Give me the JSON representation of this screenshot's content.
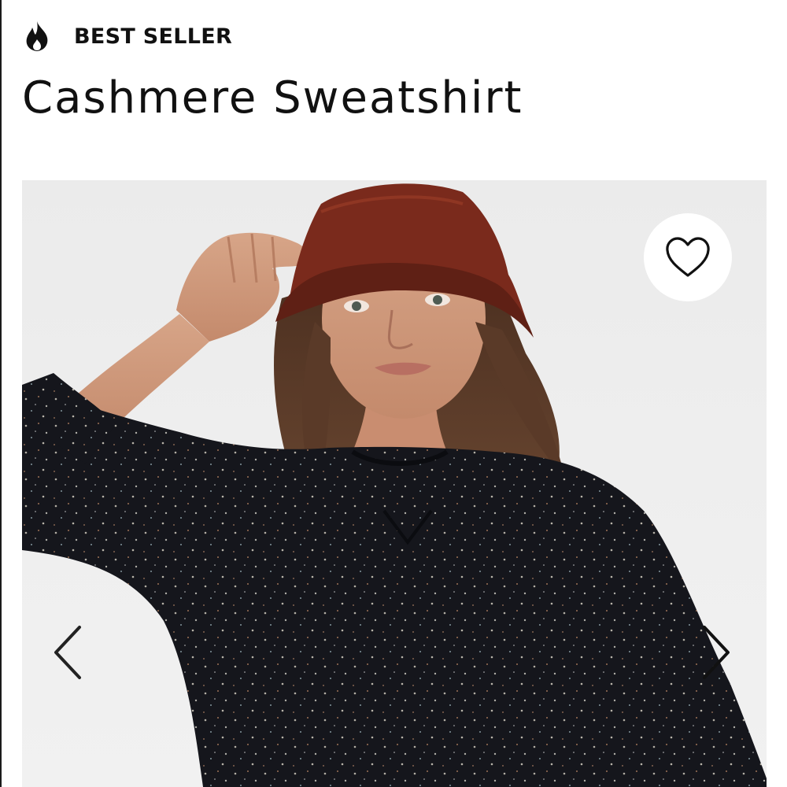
{
  "badge": {
    "icon": "flame-icon",
    "label": "BEST SELLER"
  },
  "product": {
    "title": "Cashmere Sweatshirt"
  },
  "gallery": {
    "image": "model-wearing-black-speckled-cashmere-sweatshirt-and-rust-bucket-hat",
    "favorite_icon": "heart-outline-icon",
    "prev_icon": "chevron-left-icon",
    "next_icon": "chevron-right-icon"
  },
  "colors": {
    "text": "#111111",
    "background": "#ffffff",
    "photo_background": "#eeeeee",
    "sweater": "#15161c",
    "hat": "#7a2a1c"
  }
}
